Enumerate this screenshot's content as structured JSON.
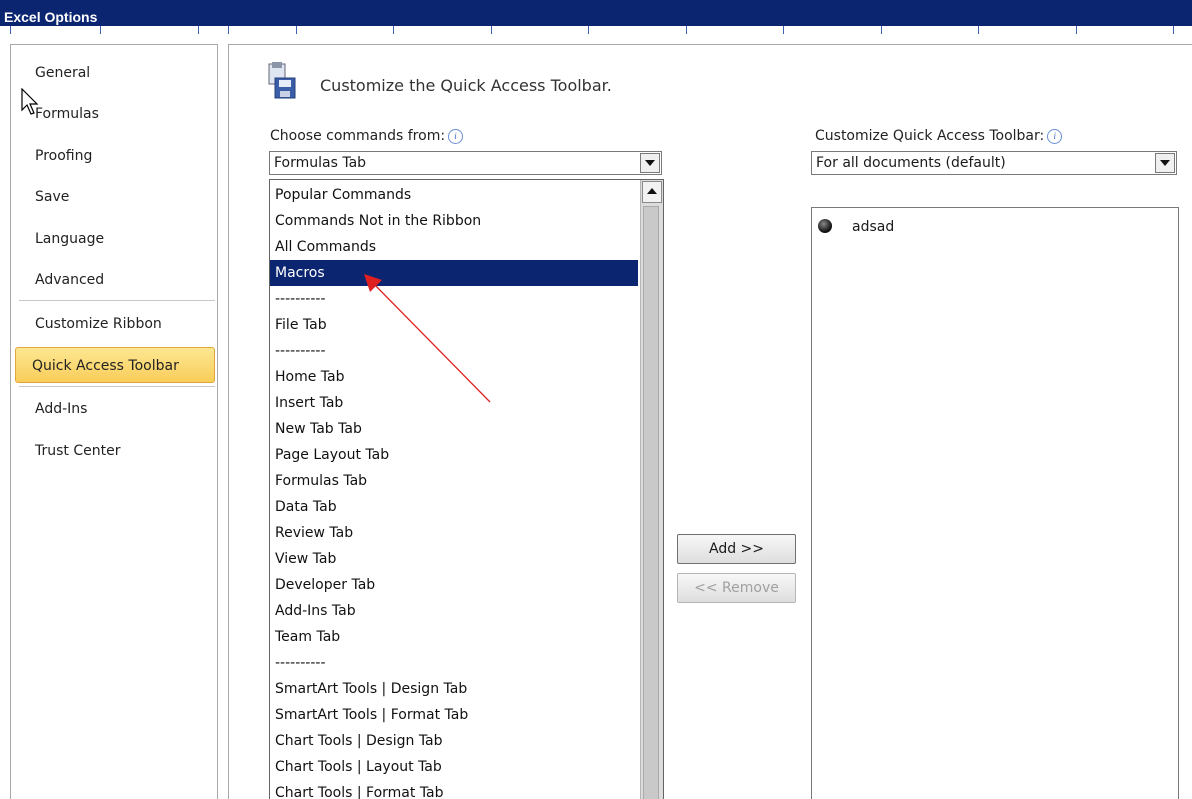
{
  "window": {
    "title": "Excel Options"
  },
  "nav": {
    "items": [
      {
        "label": "General"
      },
      {
        "label": "Formulas"
      },
      {
        "label": "Proofing"
      },
      {
        "label": "Save"
      },
      {
        "label": "Language"
      },
      {
        "label": "Advanced"
      },
      {
        "label": "Customize Ribbon"
      },
      {
        "label": "Quick Access Toolbar",
        "selected": true
      },
      {
        "label": "Add-Ins"
      },
      {
        "label": "Trust Center"
      }
    ]
  },
  "main": {
    "heading": "Customize the Quick Access Toolbar.",
    "choose_label": "Choose commands from:",
    "choose_value": "Formulas Tab",
    "customize_label": "Customize Quick Access Toolbar:",
    "customize_value": "For all documents (default)",
    "add_label": "Add >>",
    "remove_label": "<< Remove",
    "dropdown_items": [
      "Popular Commands",
      "Commands Not in the Ribbon",
      "All Commands",
      "Macros",
      "----------",
      "File Tab",
      "----------",
      "Home Tab",
      "Insert Tab",
      "New Tab Tab",
      "Page Layout Tab",
      "Formulas Tab",
      "Data Tab",
      "Review Tab",
      "View Tab",
      "Developer Tab",
      "Add-Ins Tab",
      "Team Tab",
      "----------",
      "SmartArt Tools | Design Tab",
      "SmartArt Tools | Format Tab",
      "Chart Tools | Design Tab",
      "Chart Tools | Layout Tab",
      "Chart Tools | Format Tab"
    ],
    "selected_dropdown_index": 3,
    "qat_items": [
      {
        "label": "adsad",
        "icon": "macro-ball-icon"
      }
    ]
  },
  "colors": {
    "titlebar": "#0c2570",
    "selection": "#0c2570",
    "nav_selected": "#f9cd5a",
    "annotation_arrow": "#e02020"
  }
}
